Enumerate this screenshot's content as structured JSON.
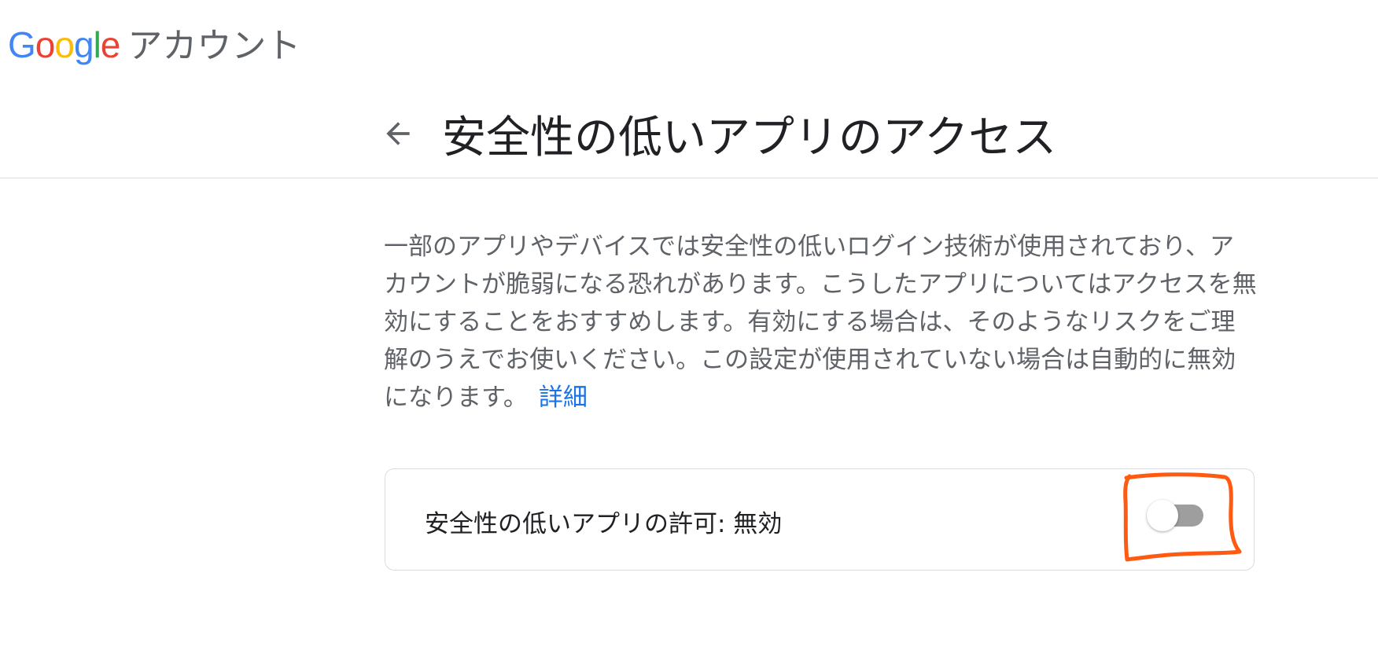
{
  "header": {
    "brand_letters": [
      {
        "char": "G",
        "color": "#4285F4"
      },
      {
        "char": "o",
        "color": "#EA4335"
      },
      {
        "char": "o",
        "color": "#FBBC05"
      },
      {
        "char": "g",
        "color": "#4285F4"
      },
      {
        "char": "l",
        "color": "#34A853"
      },
      {
        "char": "e",
        "color": "#EA4335"
      }
    ],
    "product_name": "アカウント"
  },
  "title_bar": {
    "back_icon": "arrow-left-icon",
    "title": "安全性の低いアプリのアクセス"
  },
  "description": {
    "text": "一部のアプリやデバイスでは安全性の低いログイン技術が使用されており、アカウントが脆弱になる恐れがあります。こうしたアプリについてはアクセスを無効にすることをおすすめします。有効にする場合は、そのようなリスクをご理解のうえでお使いください。この設定が使用されていない場合は自動的に無効になります。",
    "link_label": "詳細"
  },
  "setting": {
    "label": "安全性の低いアプリの許可: 無効",
    "toggle_on": false
  },
  "colors": {
    "link": "#1a73e8",
    "annotation": "#FF5A12",
    "toggle_track_off": "#9e9e9e"
  }
}
